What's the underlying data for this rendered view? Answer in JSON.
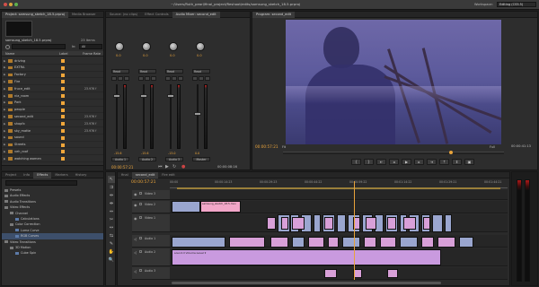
{
  "title_bar": {
    "path": "~/Users/Ruth_pearl/final_project/Reshoot/edits/samsung_sketch_18.5.prproj",
    "workspace_label": "Workspace:",
    "workspace_value": "Editing (CS5.5)"
  },
  "project_panel": {
    "tab": "Project: samsung_sketch_18.5.prproj",
    "tab_media_browser": "Media Browser",
    "project_name": "samsung_sketch_18.5.prproj",
    "item_count": "23 Items",
    "in_label": "In:",
    "in_value": "All",
    "columns": [
      "Name",
      "Label",
      "Frame Rate"
    ],
    "items": [
      {
        "name": "driving",
        "rate": ""
      },
      {
        "name": "EXTRA",
        "rate": ""
      },
      {
        "name": "Factory",
        "rate": ""
      },
      {
        "name": "Fire",
        "rate": ""
      },
      {
        "name": "fruce_edit",
        "rate": "23.976 f"
      },
      {
        "name": "nia_room",
        "rate": ""
      },
      {
        "name": "Park",
        "rate": ""
      },
      {
        "name": "people",
        "rate": ""
      },
      {
        "name": "second_edit",
        "rate": "23.976 f"
      },
      {
        "name": "shopfx",
        "rate": "23.976 f"
      },
      {
        "name": "sky_matte",
        "rate": "23.976 f"
      },
      {
        "name": "sound",
        "rate": ""
      },
      {
        "name": "Streets",
        "rate": ""
      },
      {
        "name": "veh_roof",
        "rate": ""
      },
      {
        "name": "watching women",
        "rate": ""
      }
    ]
  },
  "mixer_panel": {
    "tabs": [
      "Source: (no clips)",
      "Effect Controls",
      "Audio Mixer: second_edit"
    ],
    "channels": [
      {
        "mode": "Read",
        "value": "0.0",
        "label": "Audio 1",
        "db": "-15.6"
      },
      {
        "mode": "Read",
        "value": "0.0",
        "label": "Audio 2",
        "db": "-15.6"
      },
      {
        "mode": "Read",
        "value": "0.0",
        "label": "Audio 3",
        "db": "-13.0"
      },
      {
        "mode": "Read",
        "value": "0.0",
        "label": "Master",
        "db": "0.0"
      }
    ],
    "timecode_left": "00:00:57:21",
    "timecode_right": "00:00:08:16"
  },
  "program_panel": {
    "tab": "Program: second_edit",
    "timecode": "00:00:57:21",
    "fit_label": "Fit",
    "quality_label": "Full",
    "duration": "00:00:41:13"
  },
  "effects_panel": {
    "tabs": [
      "Project",
      "Info",
      "Effects",
      "Markers",
      "History"
    ],
    "items": [
      {
        "label": "Presets",
        "indent": 0
      },
      {
        "label": "Audio Effects",
        "indent": 0
      },
      {
        "label": "Audio Transitions",
        "indent": 0
      },
      {
        "label": "Video Effects",
        "indent": 0
      },
      {
        "label": "Channel",
        "indent": 1
      },
      {
        "label": "Calculations",
        "indent": 2
      },
      {
        "label": "Color Correction",
        "indent": 1
      },
      {
        "label": "Luma Curve",
        "indent": 2
      },
      {
        "label": "RGB Curves",
        "indent": 2
      },
      {
        "label": "Video Transitions",
        "indent": 0
      },
      {
        "label": "3D Motion",
        "indent": 1
      },
      {
        "label": "Cube Spin",
        "indent": 2
      }
    ]
  },
  "timeline": {
    "tabs": [
      "final",
      "second_edit",
      "Fire edit"
    ],
    "timecode": "00:00:57:21",
    "ruler": [
      "00:00",
      "00:00:14:23",
      "00:00:29:23",
      "00:00:44:22",
      "00:00:59:22",
      "00:01:14:22",
      "00:01:29:21",
      "00:01:44:21"
    ],
    "tracks": [
      "Video 3",
      "Video 2",
      "Video 1",
      "Audio 1",
      "Audio 2",
      "Audio 3"
    ],
    "clip_label_top": "samsung_sketch_18.5.mov",
    "clip_label_audio": "sound.ll  Volume:Level ▾"
  }
}
